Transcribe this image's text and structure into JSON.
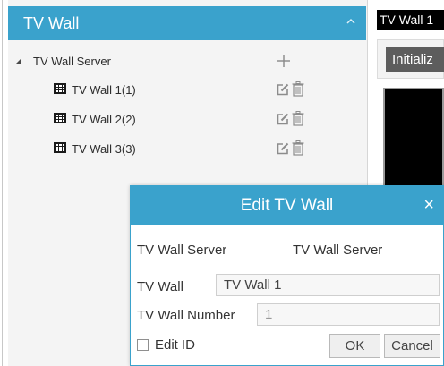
{
  "panel": {
    "title": "TV Wall"
  },
  "tree": {
    "server": {
      "label": "TV Wall Server"
    },
    "walls": [
      {
        "label": "TV Wall 1(1)"
      },
      {
        "label": "TV Wall 2(2)"
      },
      {
        "label": "TV Wall 3(3)"
      }
    ]
  },
  "right_panel": {
    "tab_label": "TV Wall 1",
    "initialize_label": "Initializ"
  },
  "dialog": {
    "title": "Edit TV Wall",
    "close_glyph": "×",
    "server_label": "TV Wall Server",
    "server_value": "TV Wall Server",
    "wall_label": "TV Wall",
    "wall_value": "TV Wall 1",
    "number_label": "TV Wall Number",
    "number_value": "1",
    "edit_id_label": "Edit ID",
    "ok_label": "OK",
    "cancel_label": "Cancel"
  },
  "icons": {
    "collapse": "chevron-up-icon",
    "expand": "triangle-down-icon",
    "add": "plus-icon",
    "wall": "tv-wall-grid-icon",
    "edit": "edit-icon",
    "delete": "trash-icon"
  },
  "colors": {
    "accent": "#3aa2cc",
    "panel_bg": "#f4f4f4",
    "icon_gray": "#8c8c8c"
  }
}
